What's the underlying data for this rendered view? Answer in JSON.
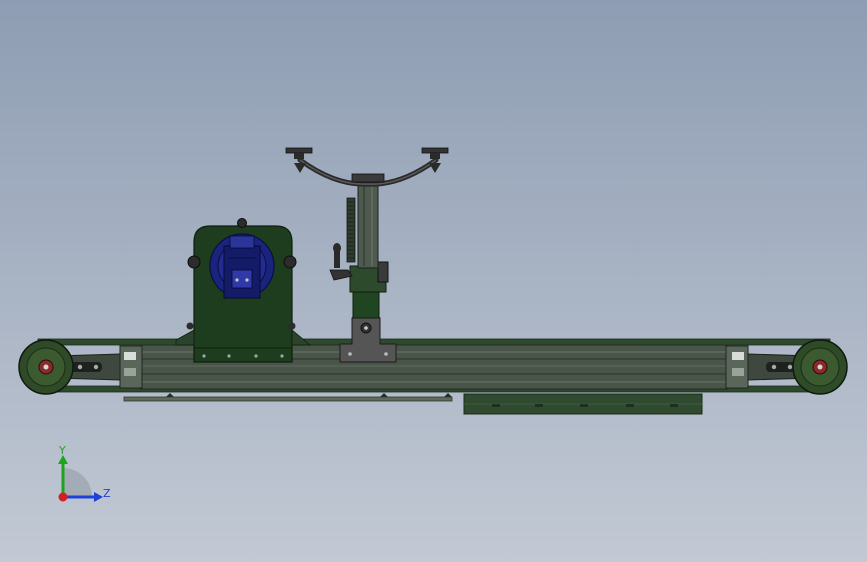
{
  "viewport": {
    "background_top": "#8e9db3",
    "background_bottom": "#c2c9d4"
  },
  "model": {
    "frame_color": "#3c4a3c",
    "green_color": "#1e3d1e",
    "motor_color": "#1a237e",
    "roller_color": "#2e4a26",
    "components": [
      {
        "icon": "conveyor-frame-icon"
      },
      {
        "icon": "drive-roller-icon"
      },
      {
        "icon": "idler-roller-icon"
      },
      {
        "icon": "motor-housing-icon"
      },
      {
        "icon": "motor-icon"
      },
      {
        "icon": "support-column-icon"
      },
      {
        "icon": "fork-holder-icon"
      },
      {
        "icon": "clamp-handle-icon"
      },
      {
        "icon": "lower-rail-icon"
      },
      {
        "icon": "side-plate-icon"
      }
    ]
  },
  "triad": {
    "y_label": "Y",
    "z_label": "Z",
    "y_color": "#1fa31f",
    "z_color": "#1f3fd6",
    "x_color": "#d21f1f"
  }
}
